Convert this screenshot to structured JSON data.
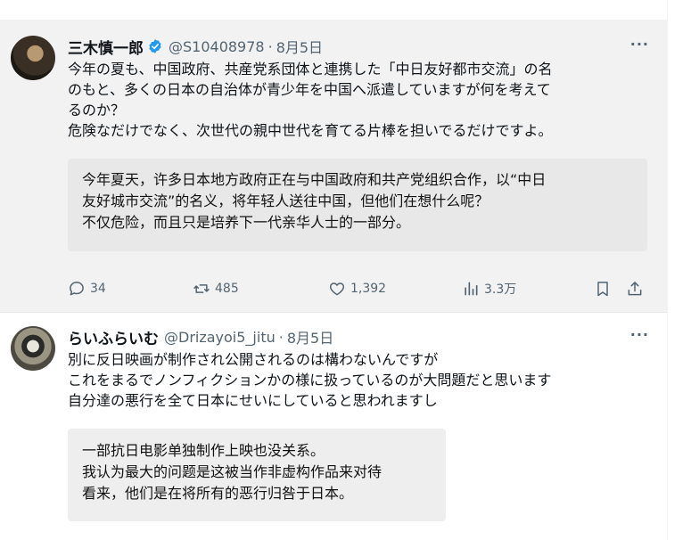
{
  "posts": [
    {
      "author": "三木慎一郎",
      "verified": true,
      "handle": "@S10408978",
      "separator": "·",
      "date": "8月5日",
      "more": "···",
      "text_lines": [
        "今年の夏も、中国政府、共産党系団体と連携した「中日友好都市交流」の名",
        "のもと、多くの日本の自治体が青少年を中国へ派遣していますが何を考えて",
        "るのか？",
        "危険なだけでなく、次世代の親中世代を育てる片棒を担いでるだけですよ。"
      ],
      "translation_lines": [
        "今年夏天，许多日本地方政府正在与中国政府和共产党组织合作，以“中日",
        "友好城市交流”的名义，将年轻人送往中国，但他们在想什么呢？",
        "不仅危险，而且只是培养下一代亲华人士的一部分。"
      ],
      "stats": {
        "replies": "34",
        "reposts": "485",
        "likes": "1,392",
        "views": "3.3万"
      }
    },
    {
      "author": "らいふらいむ",
      "verified": false,
      "handle": "@Drizayoi5_jitu",
      "separator": "·",
      "date": "8月5日",
      "more": "···",
      "text_lines": [
        "別に反日映画が制作され公開されるのは構わないんですが",
        "これをまるでノンフィクションかの様に扱っているのが大問題だと思います",
        "自分達の悪行を全て日本にせいにしていると思われますし"
      ],
      "translation_lines": [
        "一部抗日电影单独制作上映也没关系。",
        "我认为最大的问题是这被当作非虚构作品来对待",
        "看来，他们是在将所有的恶行归咎于日本。"
      ]
    }
  ],
  "colors": {
    "verified_badge": "#1d9bf0",
    "muted_text": "#536471"
  },
  "icons": [
    "reply-icon",
    "repost-icon",
    "like-icon",
    "views-icon",
    "bookmark-icon",
    "share-icon",
    "verified-badge-icon",
    "more-icon"
  ]
}
